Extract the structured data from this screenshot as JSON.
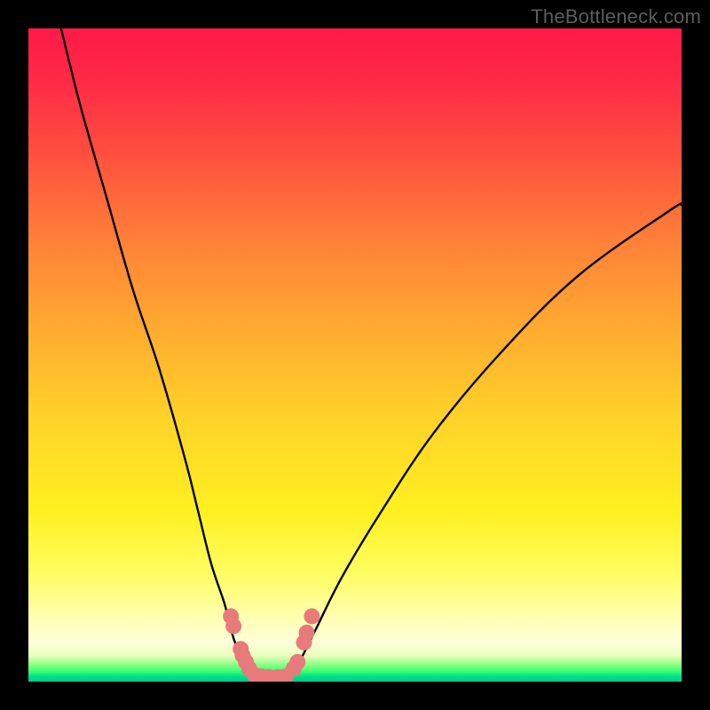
{
  "watermark": "TheBottleneck.com",
  "chart_data": {
    "type": "line",
    "title": "",
    "xlabel": "",
    "ylabel": "",
    "xlim": [
      0,
      100
    ],
    "ylim": [
      0,
      100
    ],
    "background": "red-to-green vertical gradient (bottleneck heatmap)",
    "series": [
      {
        "name": "left-curve",
        "x": [
          5,
          8,
          12,
          16,
          20,
          24,
          26,
          28,
          30,
          31,
          32,
          33,
          34,
          35
        ],
        "values": [
          100,
          88,
          74,
          60,
          48,
          34,
          26,
          18,
          12,
          8,
          5,
          3,
          1.5,
          0.8
        ]
      },
      {
        "name": "right-curve",
        "x": [
          40,
          41,
          42,
          44,
          48,
          54,
          62,
          72,
          84,
          98,
          100
        ],
        "values": [
          0.8,
          2,
          4,
          8,
          16,
          26,
          38,
          50,
          62,
          72,
          73
        ]
      }
    ],
    "markers": [
      {
        "name": "left-upper-marker",
        "x": 31.0,
        "y": 10
      },
      {
        "name": "left-upper-marker2",
        "x": 31.4,
        "y": 8.5
      },
      {
        "name": "left-lower-marker",
        "x": 32.5,
        "y": 5
      },
      {
        "name": "left-lower-marker2",
        "x": 32.8,
        "y": 4
      },
      {
        "name": "left-lower-marker3",
        "x": 33.3,
        "y": 3
      },
      {
        "name": "left-lower-marker4",
        "x": 33.8,
        "y": 2
      },
      {
        "name": "floor-marker-1",
        "x": 34.6,
        "y": 1
      },
      {
        "name": "floor-marker-2",
        "x": 35.6,
        "y": 0.8
      },
      {
        "name": "floor-marker-3",
        "x": 36.8,
        "y": 0.7
      },
      {
        "name": "floor-marker-4",
        "x": 38.2,
        "y": 0.7
      },
      {
        "name": "floor-marker-5",
        "x": 39.4,
        "y": 0.8
      },
      {
        "name": "right-lower-marker",
        "x": 40.6,
        "y": 2
      },
      {
        "name": "right-lower-marker2",
        "x": 41.2,
        "y": 3
      },
      {
        "name": "right-upper-marker",
        "x": 42.2,
        "y": 6
      },
      {
        "name": "right-upper-marker2",
        "x": 42.6,
        "y": 7.5
      },
      {
        "name": "right-upper-marker3",
        "x": 43.4,
        "y": 10
      }
    ],
    "marker_color": "#e77a7a",
    "curve_color": "#000000"
  }
}
